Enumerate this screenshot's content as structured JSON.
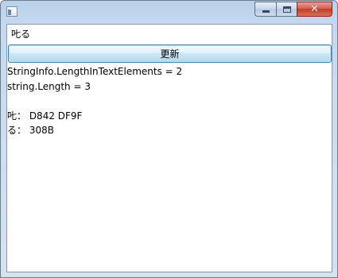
{
  "window": {
    "icon": "window-app-icon",
    "caption_buttons": [
      "minimize-icon",
      "maximize-icon",
      "close-icon"
    ],
    "close_color": "#c03a22"
  },
  "input": {
    "value": "𠮟る"
  },
  "button": {
    "label": "更新"
  },
  "output": {
    "lines": [
      "StringInfo.LengthInTextElements = 2",
      "string.Length = 3",
      "",
      "𠮟： D842 DF9F",
      "る： 308B"
    ]
  }
}
